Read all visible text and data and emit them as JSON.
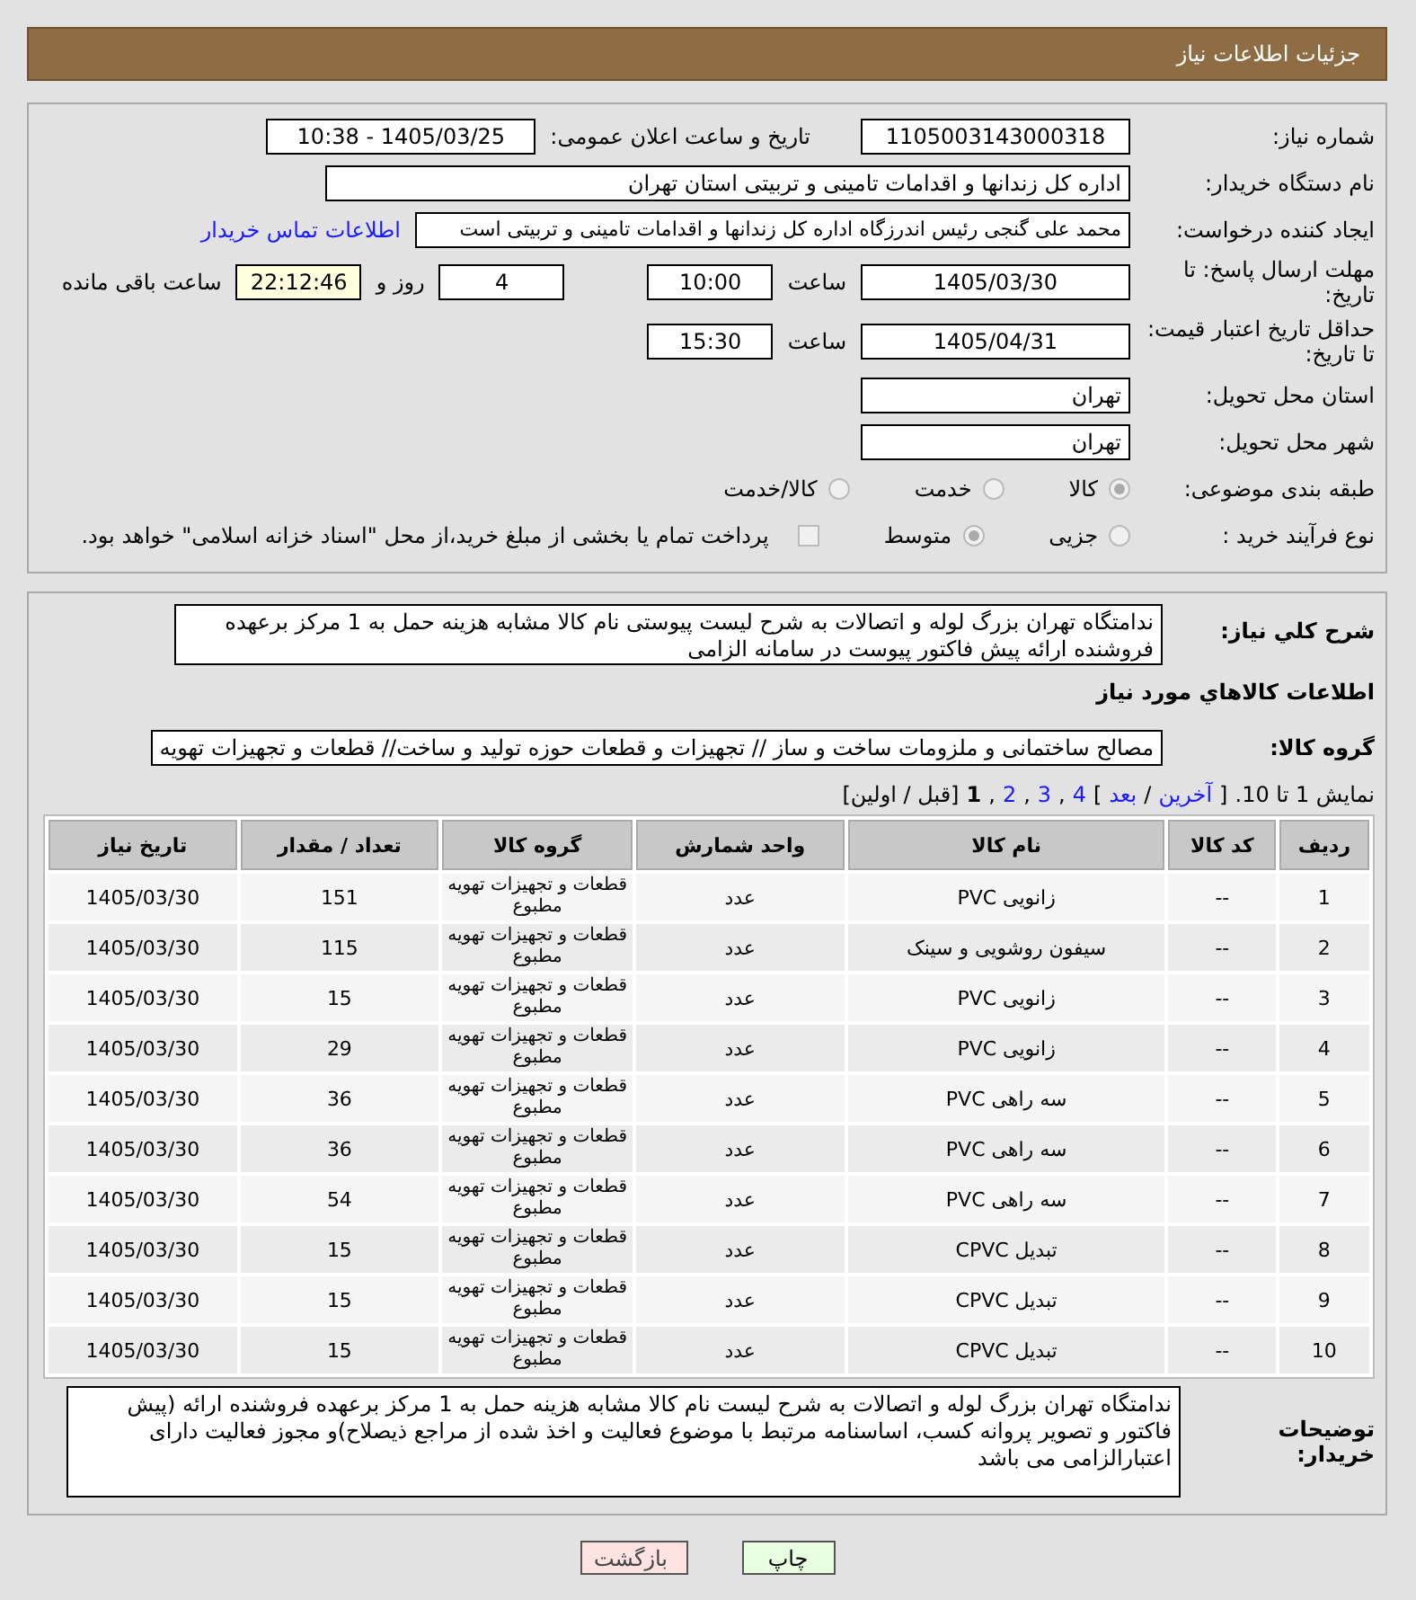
{
  "header": {
    "title": "جزئیات اطلاعات نیاز"
  },
  "form": {
    "need_number": {
      "label": "شماره نیاز:",
      "value": "1105003143000318"
    },
    "announce": {
      "label": "تاریخ و ساعت اعلان عمومی:",
      "value": "1405/03/25 - 10:38"
    },
    "buyer_org": {
      "label": "نام دستگاه خریدار:",
      "value": "اداره کل زندانها و اقدامات تامینی و تربیتی استان تهران"
    },
    "requester": {
      "label": "ایجاد کننده درخواست:",
      "value": "محمد علی گنجی رئیس اندرزگاه  اداره کل زندانها و اقدامات تامینی و تربیتی است",
      "link": "اطلاعات تماس خریدار"
    },
    "deadline": {
      "label": "مهلت ارسال پاسخ: تا تاریخ:",
      "date": "1405/03/30",
      "time_label": "ساعت",
      "time": "10:00",
      "days": "4",
      "days_label": "روز و",
      "remaining": "22:12:46",
      "remaining_label": "ساعت باقی مانده"
    },
    "validity": {
      "label": "حداقل تاریخ اعتبار قیمت: تا تاریخ:",
      "date": "1405/04/31",
      "time_label": "ساعت",
      "time": "15:30"
    },
    "province": {
      "label": "استان محل تحویل:",
      "value": "تهران"
    },
    "city": {
      "label": "شهر محل تحویل:",
      "value": "تهران"
    },
    "category": {
      "label": "طبقه بندی موضوعی:",
      "options": [
        {
          "label": "کالا",
          "selected": true
        },
        {
          "label": "خدمت",
          "selected": false
        },
        {
          "label": "کالا/خدمت",
          "selected": false
        }
      ]
    },
    "process": {
      "label": "نوع فرآیند خرید :",
      "options": [
        {
          "label": "جزیی",
          "selected": false
        },
        {
          "label": "متوسط",
          "selected": true
        }
      ],
      "payment_checked": false,
      "payment_text": "پرداخت تمام یا بخشی از مبلغ خرید،از محل \"اسناد خزانه اسلامی\" خواهد بود."
    }
  },
  "summary": {
    "label": "شرح كلي نياز:",
    "value": "ندامتگاه تهران بزرگ لوله و اتصالات به شرح لیست پیوستی نام کالا مشابه هزینه حمل به 1 مرکز برعهده فروشنده ارائه پیش فاکتور  پیوست در سامانه الزامی"
  },
  "goods_title": "اطلاعات كالاهاي مورد نياز",
  "goods_group": {
    "label": "گروه کالا:",
    "value": "مصالح ساختمانی و ملزومات ساخت و ساز // تجهیزات و قطعات حوزه تولید و ساخت//  قطعات و تجهیزات تهویه"
  },
  "pager": [
    {
      "text": "نمایش 1 تا 10.",
      "kind": "text"
    },
    {
      "text": "[",
      "kind": "text"
    },
    {
      "text": "آخرین",
      "kind": "link"
    },
    {
      "text": "/",
      "kind": "text"
    },
    {
      "text": "بعد",
      "kind": "link"
    },
    {
      "text": "]",
      "kind": "text"
    },
    {
      "text": "4",
      "kind": "link"
    },
    {
      "text": ",",
      "kind": "text"
    },
    {
      "text": "3",
      "kind": "link"
    },
    {
      "text": ",",
      "kind": "text"
    },
    {
      "text": "2",
      "kind": "link"
    },
    {
      "text": ",",
      "kind": "text"
    },
    {
      "text": "1",
      "kind": "current"
    },
    {
      "text": "[قبل / اولین]",
      "kind": "text"
    }
  ],
  "table": {
    "columns": [
      "ردیف",
      "کد کالا",
      "نام کالا",
      "واحد شمارش",
      "گروه کالا",
      "تعداد / مقدار",
      "تاریخ نیاز"
    ],
    "rows": [
      [
        "1",
        "--",
        "زانویی PVC",
        "عدد",
        "قطعات و تجهیزات تهویه مطبوع",
        "151",
        "1405/03/30"
      ],
      [
        "2",
        "--",
        "سیفون روشویی و سینک",
        "عدد",
        "قطعات و تجهیزات تهویه مطبوع",
        "115",
        "1405/03/30"
      ],
      [
        "3",
        "--",
        "زانویی PVC",
        "عدد",
        "قطعات و تجهیزات تهویه مطبوع",
        "15",
        "1405/03/30"
      ],
      [
        "4",
        "--",
        "زانویی PVC",
        "عدد",
        "قطعات و تجهیزات تهویه مطبوع",
        "29",
        "1405/03/30"
      ],
      [
        "5",
        "--",
        "سه راهی PVC",
        "عدد",
        "قطعات و تجهیزات تهویه مطبوع",
        "36",
        "1405/03/30"
      ],
      [
        "6",
        "--",
        "سه راهی PVC",
        "عدد",
        "قطعات و تجهیزات تهویه مطبوع",
        "36",
        "1405/03/30"
      ],
      [
        "7",
        "--",
        "سه راهی PVC",
        "عدد",
        "قطعات و تجهیزات تهویه مطبوع",
        "54",
        "1405/03/30"
      ],
      [
        "8",
        "--",
        "تبدیل CPVC",
        "عدد",
        "قطعات و تجهیزات تهویه مطبوع",
        "15",
        "1405/03/30"
      ],
      [
        "9",
        "--",
        "تبدیل CPVC",
        "عدد",
        "قطعات و تجهیزات تهویه مطبوع",
        "15",
        "1405/03/30"
      ],
      [
        "10",
        "--",
        "تبدیل CPVC",
        "عدد",
        "قطعات و تجهیزات تهویه مطبوع",
        "15",
        "1405/03/30"
      ]
    ]
  },
  "buyer_notes": {
    "label": "توضیحات خریدار:",
    "value": "ندامتگاه تهران بزرگ لوله و اتصالات به شرح لیست نام کالا مشابه هزینه حمل  به 1 مرکز برعهده فروشنده ارائه (پیش فاکتور و تصویر پروانه کسب، اساسنامه مرتبط با موضوع فعالیت و اخذ شده از مراجع ذیصلاح)و مجوز فعالیت دارای اعتبارالزامی می باشد"
  },
  "buttons": [
    {
      "label": "چاپ",
      "kind": "print"
    },
    {
      "label": "بازگشت",
      "kind": "back"
    }
  ]
}
